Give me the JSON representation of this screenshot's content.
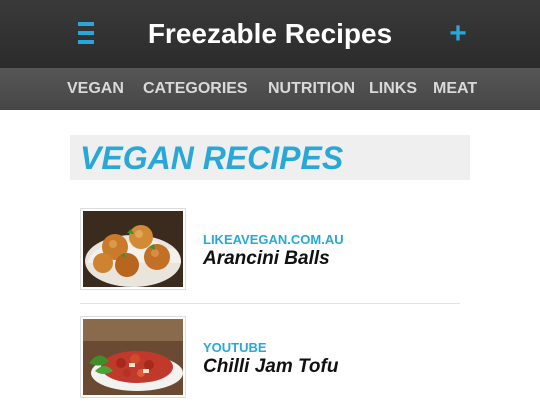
{
  "header": {
    "title": "Freezable Recipes",
    "menu_icon": "hamburger-menu-icon",
    "add_icon": "plus-icon",
    "add_glyph": "+",
    "accent_color": "#27a8d8"
  },
  "nav": {
    "items": [
      {
        "label": "VEGAN"
      },
      {
        "label": "CATEGORIES"
      },
      {
        "label": "NUTRITION"
      },
      {
        "label": "LINKS"
      },
      {
        "label": "MEAT"
      }
    ]
  },
  "section": {
    "title": "VEGAN RECIPES"
  },
  "recipes": [
    {
      "source": "LIKEAVEGAN.COM.AU",
      "name": "Arancini Balls",
      "image": "arancini-balls-photo"
    },
    {
      "source": "YOUTUBE",
      "name": "Chilli Jam Tofu",
      "image": "chilli-jam-tofu-photo"
    }
  ]
}
